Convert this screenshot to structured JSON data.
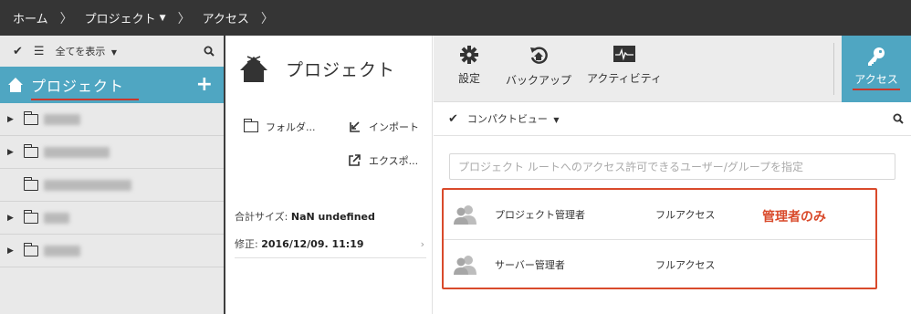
{
  "breadcrumb": {
    "items": [
      "ホーム",
      "プロジェクト",
      "アクセス"
    ],
    "separator": ">"
  },
  "sidebar": {
    "show_all_label": "全てを表示",
    "header_title": "プロジェクト",
    "add_icon": "plus-icon"
  },
  "project_panel": {
    "title": "プロジェクト",
    "actions": {
      "folder": "フォルダ...",
      "import": "インポート",
      "export": "エクスポ..."
    },
    "total_size_label": "合計サイズ:",
    "total_size_value": "NaN undefined",
    "modified_label": "修正:",
    "modified_value": "2016/12/09. 11:19"
  },
  "toolbar": {
    "settings": "設定",
    "backup": "バックアップ",
    "activity": "アクティビティ",
    "access": "アクセス"
  },
  "view": {
    "label": "コンパクトビュー"
  },
  "access": {
    "search_placeholder": "プロジェクト ルートへのアクセス許可できるユーザー/グループを指定",
    "rows": [
      {
        "name": "プロジェクト管理者",
        "level": "フルアクセス"
      },
      {
        "name": "サーバー管理者",
        "level": "フルアクセス"
      }
    ],
    "annotation": "管理者のみ"
  },
  "colors": {
    "accent": "#4fa6c2",
    "annotation": "#d94a2b",
    "topbar": "#353535"
  }
}
